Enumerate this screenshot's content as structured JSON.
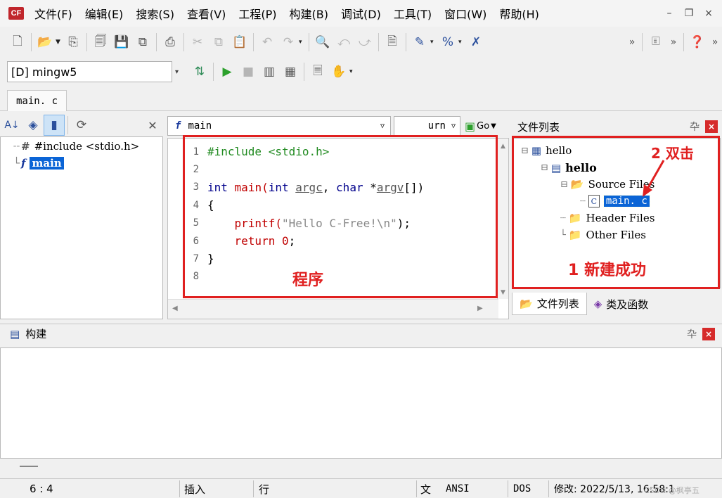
{
  "app": {
    "icon_text": "CF"
  },
  "menu": {
    "items": [
      "文件(F)",
      "编辑(E)",
      "搜索(S)",
      "查看(V)",
      "工程(P)",
      "构建(B)",
      "调试(D)",
      "工具(T)",
      "窗口(W)",
      "帮助(H)"
    ]
  },
  "window_controls": {
    "minimize": "–",
    "restore": "❐",
    "close": "×"
  },
  "toolbar2": {
    "compiler_value": "[D] mingw5"
  },
  "tabs": {
    "active": "main. c"
  },
  "left_panel": {
    "items": [
      {
        "icon": "#",
        "label": "#include <stdio.h>"
      },
      {
        "icon": "f",
        "label": "main"
      }
    ]
  },
  "editor": {
    "func_combo": "main",
    "func_combo2": "urn",
    "go_label": "Go",
    "lines": [
      {
        "n": "1",
        "parts": [
          {
            "t": "#include <stdio.h>",
            "c": "pp"
          }
        ]
      },
      {
        "n": "2",
        "parts": []
      },
      {
        "n": "3",
        "parts": [
          {
            "t": "int",
            "c": "kw"
          },
          {
            "t": " main(",
            "c": "rd"
          },
          {
            "t": "int",
            "c": "kw"
          },
          {
            "t": " ",
            "c": ""
          },
          {
            "t": "argc",
            "c": "ul"
          },
          {
            "t": ", ",
            "c": ""
          },
          {
            "t": "char",
            "c": "kw"
          },
          {
            "t": " *",
            "c": ""
          },
          {
            "t": "argv",
            "c": "ul"
          },
          {
            "t": "[])",
            "c": ""
          }
        ]
      },
      {
        "n": "4",
        "parts": [
          {
            "t": "{",
            "c": ""
          }
        ]
      },
      {
        "n": "5",
        "parts": [
          {
            "t": "    printf(",
            "c": "rd"
          },
          {
            "t": "\"Hello C-Free!\\n\"",
            "c": "st"
          },
          {
            "t": ");",
            "c": ""
          }
        ]
      },
      {
        "n": "6",
        "parts": [
          {
            "t": "    return",
            "c": "rd"
          },
          {
            "t": " 0",
            "c": "rd"
          },
          {
            "t": ";",
            "c": ""
          }
        ]
      },
      {
        "n": "7",
        "parts": [
          {
            "t": "}",
            "c": ""
          }
        ]
      },
      {
        "n": "8",
        "parts": []
      }
    ]
  },
  "file_list": {
    "title": "文件列表",
    "nodes": [
      {
        "label": "hello",
        "icon": "▦",
        "bold": false
      },
      {
        "label": "hello",
        "icon": "▤",
        "bold": true
      },
      {
        "label": "Source Files",
        "icon": "📂",
        "bold": false
      },
      {
        "label": "main. c",
        "icon": "C",
        "bold": false
      },
      {
        "label": "Header Files",
        "icon": "📁",
        "bold": false
      },
      {
        "label": "Other Files",
        "icon": "📁",
        "bold": false
      }
    ],
    "tab_files": "文件列表",
    "tab_classes": "类及函数"
  },
  "build": {
    "title": "构建"
  },
  "annotations": {
    "program": "程序",
    "double_click": "2 双击",
    "new_success": "1 新建成功"
  },
  "status": {
    "position": "6 :   4",
    "insert": "插入",
    "line": "行",
    "file": "文",
    "encoding": "ANSI",
    "lineend": "DOS",
    "modified": "修改: 2022/5/13, 16:58:1",
    "watermark": "CSDN @枫亭五"
  },
  "colors": {
    "annotation": "#e02020",
    "selection": "#0a64d6"
  }
}
